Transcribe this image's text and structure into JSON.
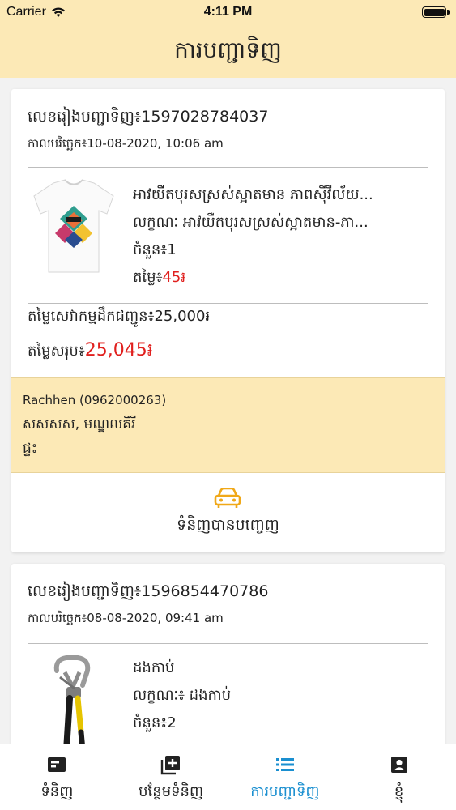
{
  "status_bar": {
    "carrier": "Carrier",
    "time": "4:11 PM",
    "wifi_icon": "wifi-icon",
    "battery_icon": "battery-icon"
  },
  "nav": {
    "title": "ការបញ្ជាទិញ"
  },
  "orders": [
    {
      "order_no": "លេខរៀងបញ្ជាទិញ៖1597028784037",
      "order_date": "កាលបរិច្ឆេក៖10-08-2020, 10:06 am",
      "item": {
        "thumb_icon": "tshirt-product-image",
        "name": "អាវយឺតបុរសស្រស់ស្អាតមាន ភាពស៊ីវីល័យ...",
        "desc": "លក្ខណៈ អាវយឺតបុរសស្រស់ស្អាតមាន-ភា...",
        "qty": "ចំនួន៖1",
        "price_label": "តម្លៃ៖",
        "price_value": "45៛"
      },
      "delivery_fee": "តម្លៃសេវាកម្មដឹកជញ្ជូន៖25,000៛",
      "total_label": "តម្លៃសរុប៖",
      "total_value": "25,045៛",
      "address": {
        "name": "Rachhen (0962000263)",
        "place": "សសសស, មណ្ឌលគិរី",
        "house": "ផ្ទះ"
      },
      "status_icon": "car-icon",
      "status": "ទំនិញបានបញ្ចេញ"
    },
    {
      "order_no": "លេខរៀងបញ្ជាទិញ៖1596854470786",
      "order_date": "កាលបរិច្ឆេក៖08-08-2020, 09:41 am",
      "item": {
        "thumb_icon": "pliers-product-image",
        "name": "ដងកាប់",
        "desc": "លក្ខណៈ៖ ដងកាប់",
        "qty": "ចំនួន៖2"
      }
    }
  ],
  "tabs": [
    {
      "label": "ទំនិញ",
      "icon": "product-icon",
      "active": false
    },
    {
      "label": "បន្ថែមទំនិញ",
      "icon": "add-box-icon",
      "active": false
    },
    {
      "label": "ការបញ្ជាទិញ",
      "icon": "list-icon",
      "active": true
    },
    {
      "label": "ខ្ញុំ",
      "icon": "account-icon",
      "active": false
    }
  ],
  "colors": {
    "accent_yellow": "#fce9b6",
    "price_red": "#e0201e",
    "active_blue": "#1a8fd0",
    "car_orange": "#f0a818"
  }
}
